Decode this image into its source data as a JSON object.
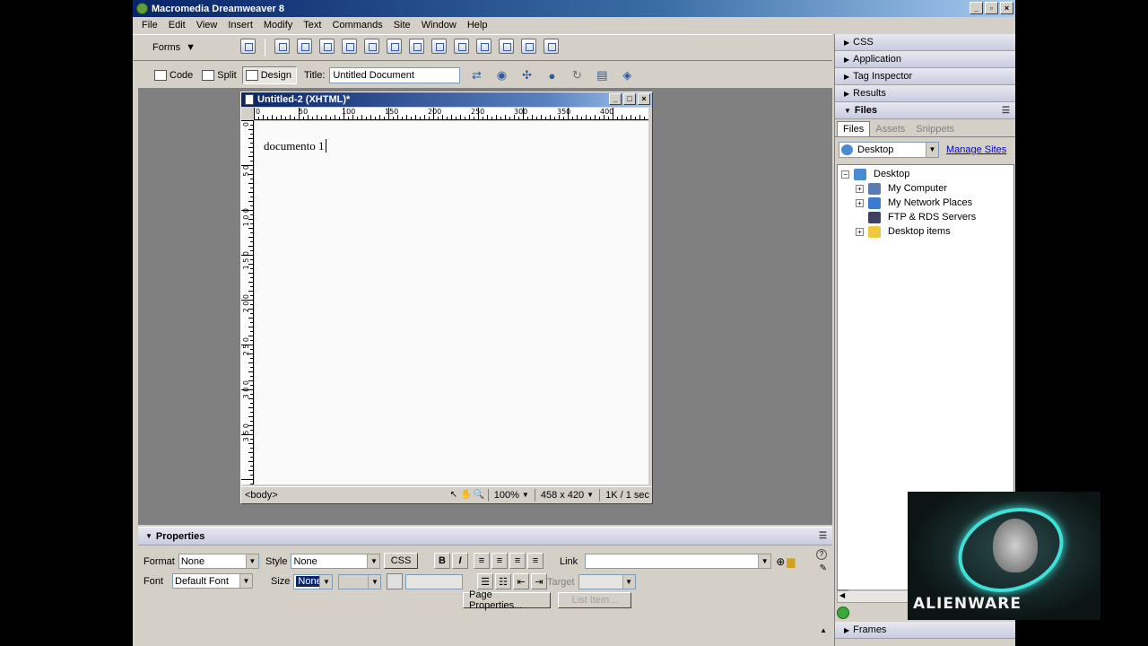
{
  "window": {
    "title": "Macromedia Dreamweaver 8",
    "controls": [
      "_",
      "▫",
      "×"
    ]
  },
  "menu": [
    "File",
    "Edit",
    "View",
    "Insert",
    "Modify",
    "Text",
    "Commands",
    "Site",
    "Window",
    "Help"
  ],
  "insert_bar": {
    "category": "Forms",
    "icon_count": 14
  },
  "doc_toolbar": {
    "code_label": "Code",
    "split_label": "Split",
    "design_label": "Design",
    "title_label": "Title:",
    "title_value": "Untitled Document",
    "icons": [
      "file-management-icon",
      "preview-icon",
      "debug-icon",
      "validate-icon",
      "refresh-icon",
      "view-options-icon",
      "visual-aids-icon"
    ]
  },
  "document": {
    "window_title": "Untitled-2 (XHTML)*",
    "ruler_h": [
      "0",
      "50",
      "100",
      "150",
      "200",
      "250",
      "300",
      "350",
      "400"
    ],
    "ruler_v": [
      "0",
      "5 0",
      "1 0 0",
      "1 5 0",
      "2 0 0",
      "2 5 0",
      "3 0 0",
      "3 5 0"
    ],
    "content": "documento 1",
    "status": {
      "tag": "<body>",
      "zoom": "100%",
      "size": "458 x 420",
      "download": "1K / 1 sec"
    }
  },
  "properties": {
    "header": "Properties",
    "format_label": "Format",
    "format_value": "None",
    "style_label": "Style",
    "style_value": "None",
    "css_button": "CSS",
    "bold": "B",
    "italic": "I",
    "link_label": "Link",
    "link_value": "",
    "font_label": "Font",
    "font_value": "Default Font",
    "size_label": "Size",
    "size_value": "None",
    "target_label": "Target",
    "page_properties": "Page Properties...",
    "list_item": "List Item..."
  },
  "panels": {
    "groups": [
      "CSS",
      "Application",
      "Tag Inspector",
      "Results"
    ],
    "files_header": "Files",
    "tabs": [
      "Files",
      "Assets",
      "Snippets"
    ],
    "site": "Desktop",
    "manage_sites": "Manage Sites",
    "tree": [
      {
        "label": "Desktop",
        "level": 0,
        "expander": "−",
        "color": "#4a8ad0"
      },
      {
        "label": "My Computer",
        "level": 1,
        "expander": "+",
        "color": "#5a7ab0"
      },
      {
        "label": "My Network Places",
        "level": 1,
        "expander": "+",
        "color": "#3a7ad0"
      },
      {
        "label": "FTP & RDS Servers",
        "level": 1,
        "expander": "",
        "color": "#404060"
      },
      {
        "label": "Desktop items",
        "level": 1,
        "expander": "+",
        "color": "#f0c840"
      }
    ],
    "frames": "Frames"
  },
  "watermark": {
    "brand": "ALIENWARE"
  }
}
